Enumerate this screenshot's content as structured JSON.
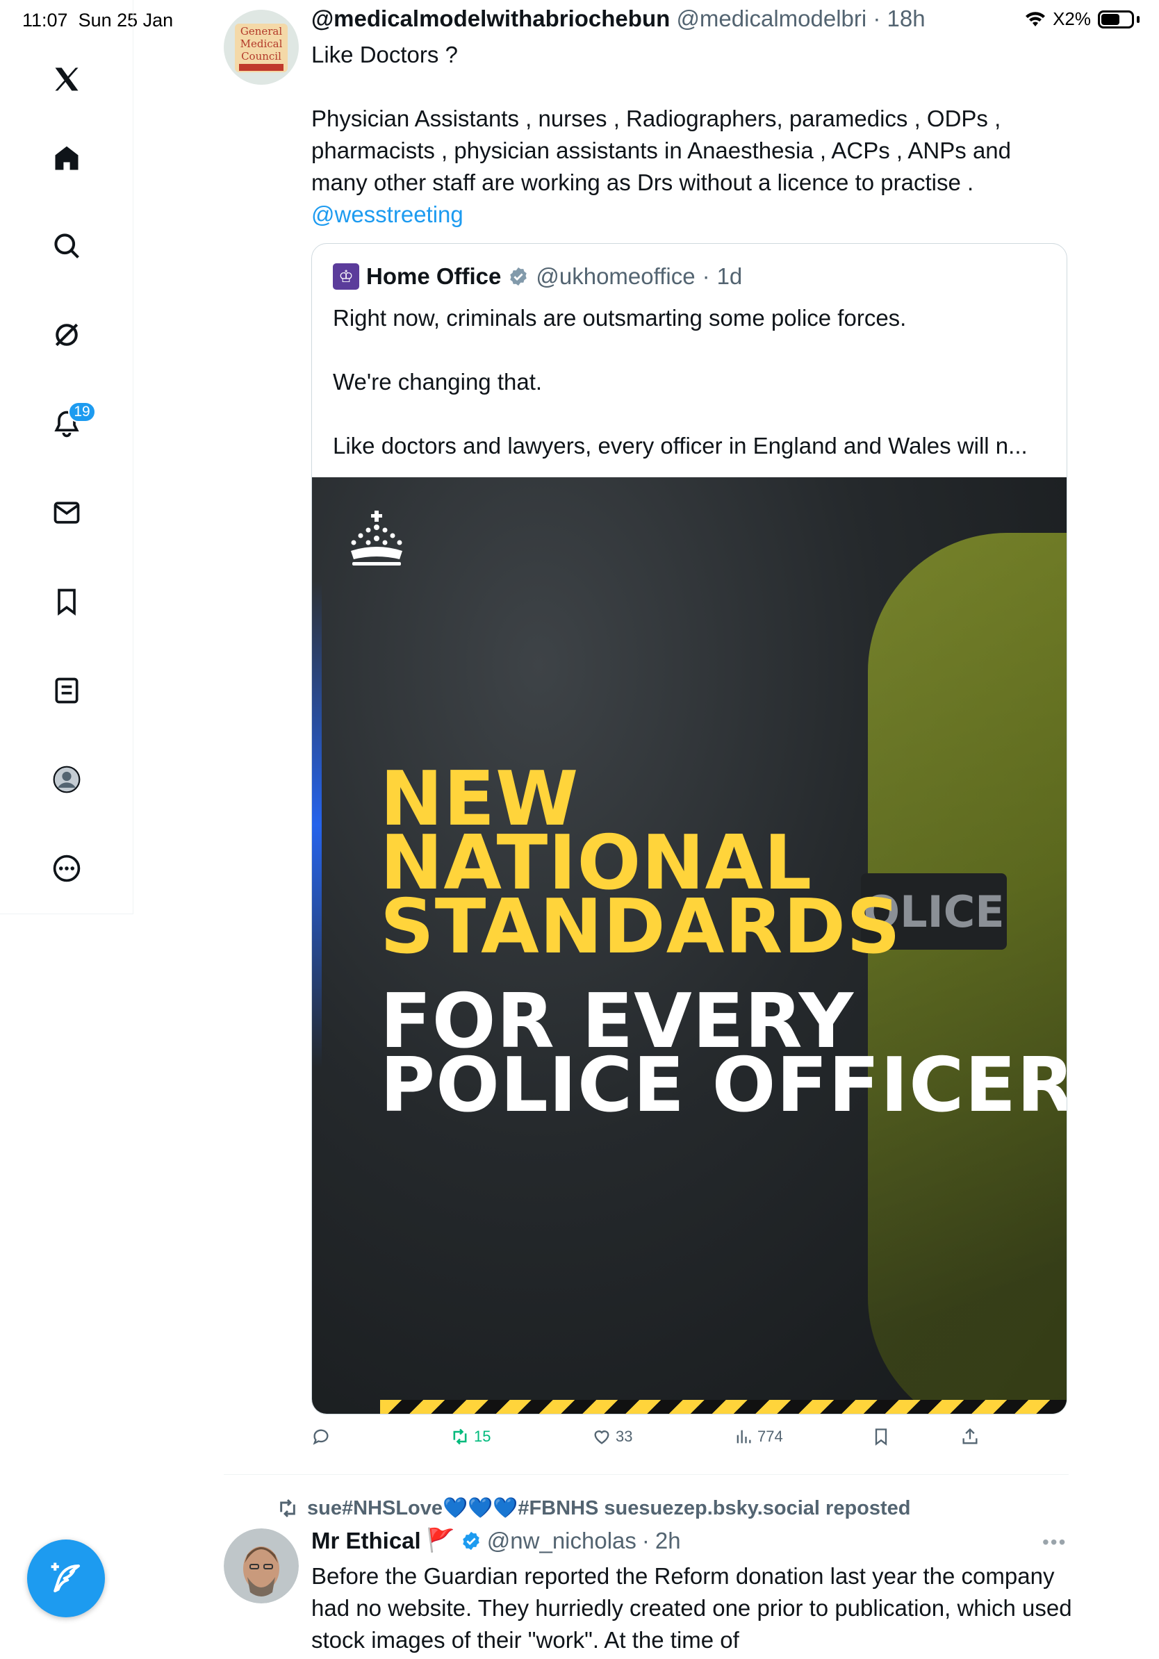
{
  "status_bar": {
    "time": "11:07",
    "date": "Sun 25 Jan",
    "battery": "62%",
    "battery_level": 0.62,
    "battery_display": "X2%"
  },
  "sidebar": {
    "items": [
      {
        "name": "x-logo-icon"
      },
      {
        "name": "home-icon"
      },
      {
        "name": "search-icon"
      },
      {
        "name": "grok-icon"
      },
      {
        "name": "notifications-icon",
        "badge": "19"
      },
      {
        "name": "messages-icon"
      },
      {
        "name": "bookmarks-icon"
      },
      {
        "name": "lists-icon"
      },
      {
        "name": "profile-icon"
      },
      {
        "name": "more-icon"
      }
    ],
    "compose_icon": "feather-plus-icon"
  },
  "tweet": {
    "author_name": "@medicalmodelwithabriochebun",
    "author_handle": "@medicalmodelbri",
    "time": "18h",
    "text_intro": "Like Doctors ?",
    "text_body": "Physician Assistants , nurses , Radiographers, paramedics , ODPs ,\npharmacists , physician assistants in Anaesthesia , ACPs , ANPs and\nmany other staff are working as Drs without a licence to practise .",
    "mention": "@wesstreeting",
    "avatar_text": [
      "General",
      "Medical",
      "Council"
    ],
    "quote": {
      "author_name": "Home Office",
      "author_handle": "@ukhomeoffice",
      "time": "1d",
      "text": "Right now, criminals are outsmarting some police forces.\n\nWe're changing that.\n\nLike doctors and lawyers, every officer in England and Wales will n...",
      "image": {
        "line1": "NEW",
        "line2": "NATIONAL",
        "line3": "STANDARDS",
        "line4": "FOR EVERY",
        "line5": "POLICE OFFICER",
        "patch": "OLICE"
      }
    },
    "actions": {
      "reply": "",
      "retweets": "15",
      "likes": "33",
      "views": "774"
    }
  },
  "tweet2": {
    "repost_label": "sue#NHSLove💙💙💙#FBNHS suesuezep.bsky.social reposted",
    "author_name": "Mr Ethical",
    "flag": "🚩",
    "author_handle": "@nw_nicholas",
    "time": "2h",
    "text": "Before the Guardian reported the Reform donation last year the company had no website. They hurriedly created one prior to publication, which used stock images of their \"work\". At the time of"
  },
  "colors": {
    "accent": "#1d9bf0",
    "retweet_green": "#00ba7c",
    "text_primary": "#0f1419",
    "text_secondary": "#536471",
    "poster_yellow": "#ffd43b"
  }
}
